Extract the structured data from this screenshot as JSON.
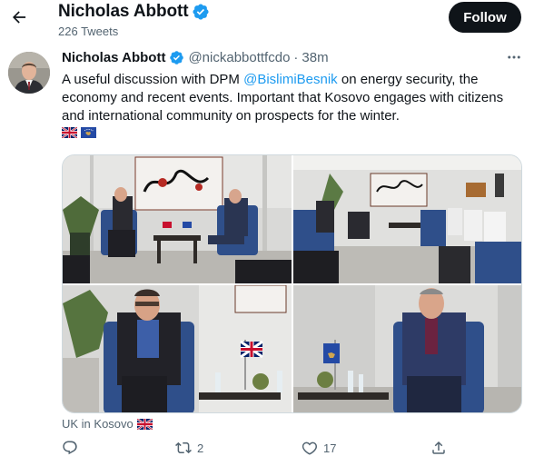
{
  "header": {
    "title": "Nicholas Abbott",
    "subtitle": "226 Tweets",
    "follow_label": "Follow"
  },
  "tweet": {
    "author_name": "Nicholas Abbott",
    "handle": "@nickabbottfcdo",
    "separator": "·",
    "time": "38m",
    "text_before": "A useful discussion with DPM ",
    "mention": "@BislimiBesnik",
    "text_after": " on energy security, the economy and recent events. Important that Kosovo engages with citizens and international community on prospects for the winter.",
    "flags": [
      "uk-flag-icon",
      "kosovo-flag-icon"
    ],
    "location": "UK in Kosovo",
    "reply_count": "",
    "retweet_count": "2",
    "like_count": "17"
  },
  "colors": {
    "accent": "#1d9bf0",
    "text": "#0f1419",
    "muted": "#536471",
    "follow_bg": "#0f1419"
  }
}
